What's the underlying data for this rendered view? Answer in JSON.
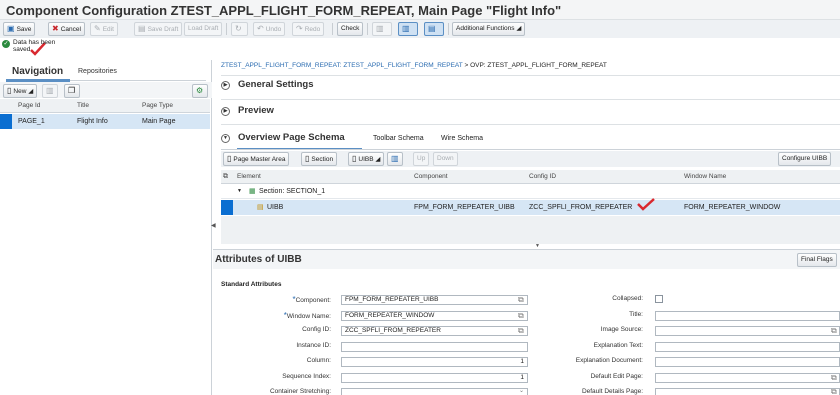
{
  "title": "Component Configuration ZTEST_APPL_FLIGHT_FORM_REPEAT, Main Page \"Flight Info\"",
  "toolbar": {
    "save": "Save",
    "cancel": "Cancel",
    "edit": "Edit",
    "save_draft": "Save Draft",
    "load_draft": "Load Draft",
    "undo": "Undo",
    "redo": "Redo",
    "check": "Check",
    "additional": "Additional Functions"
  },
  "message": "Data has been saved",
  "nav": {
    "tab_navigation": "Navigation",
    "tab_repositories": "Repositories",
    "new_label": "New",
    "columns": [
      "Page Id",
      "Title",
      "Page Type"
    ],
    "rows": [
      {
        "page_id": "PAGE_1",
        "title": "Flight Info",
        "page_type": "Main Page"
      }
    ]
  },
  "breadcrumb": {
    "link": "ZTEST_APPL_FLIGHT_FORM_REPEAT: ZTEST_APPL_FLIGHT_FORM_REPEAT",
    "separator": ">",
    "current": "OVP: ZTEST_APPL_FLIGHT_FORM_REPEAT"
  },
  "sections": {
    "general": "General Settings",
    "preview": "Preview",
    "schema": "Overview Page Schema",
    "toolbar_schema": "Toolbar Schema",
    "wire_schema": "Wire Schema"
  },
  "schema_toolbar": {
    "page_master_area": "Page Master Area",
    "section": "Section",
    "uibb": "UIBB",
    "up": "Up",
    "down": "Down",
    "configure_uibb": "Configure UIBB"
  },
  "schema_table": {
    "columns": [
      "Element",
      "Component",
      "Config ID",
      "Window Name"
    ],
    "section_row": "Section: SECTION_1",
    "uibb_row": {
      "element": "UIBB",
      "component": "FPM_FORM_REPEATER_UIBB",
      "config_id": "ZCC_SPFLI_FROM_REPEATER",
      "window_name": "FORM_REPEATER_WINDOW"
    }
  },
  "attributes": {
    "title": "Attributes of UIBB",
    "final_flags": "Final Flags",
    "standard": "Standard Attributes",
    "left": [
      {
        "label": "Component:",
        "value": "FPM_FORM_REPEATER_UIBB",
        "required": true
      },
      {
        "label": "Window Name:",
        "value": "FORM_REPEATER_WINDOW",
        "required": true
      },
      {
        "label": "Config ID:",
        "value": "ZCC_SPFLI_FROM_REPEATER",
        "required": false
      },
      {
        "label": "Instance ID:",
        "value": "",
        "required": false
      },
      {
        "label": "Column:",
        "value": "1",
        "required": false
      },
      {
        "label": "Sequence Index:",
        "value": "1",
        "required": false
      },
      {
        "label": "Container Stretching:",
        "value": "",
        "required": false
      }
    ],
    "right": [
      {
        "label": "Collapsed:"
      },
      {
        "label": "Title:"
      },
      {
        "label": "Image Source:"
      },
      {
        "label": "Explanation Text:"
      },
      {
        "label": "Explanation Document:"
      },
      {
        "label": "Default Edit Page:"
      },
      {
        "label": "Default Details Page:"
      }
    ]
  },
  "colors": {
    "accent": "#0a6ed1",
    "selected_row": "#d6e6f5",
    "check_mark": "#d9282f"
  }
}
